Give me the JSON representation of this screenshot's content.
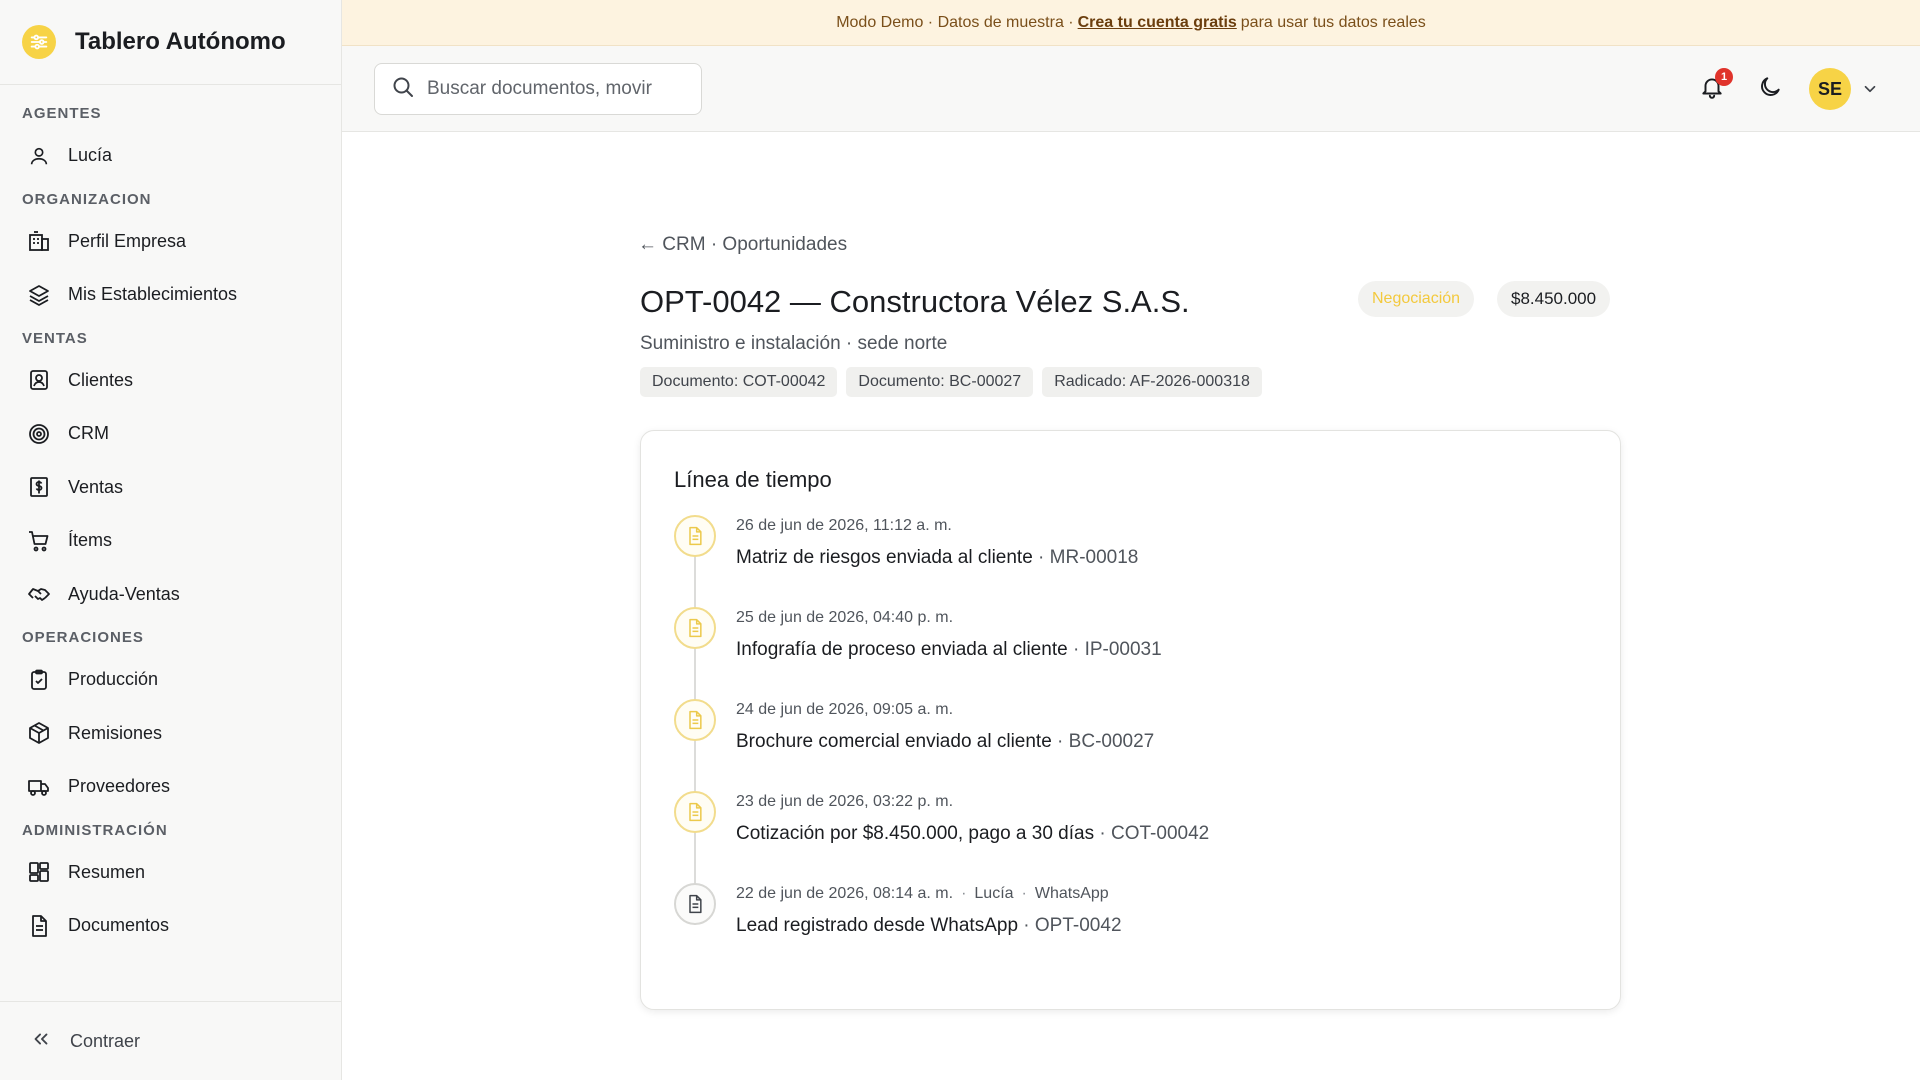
{
  "app": {
    "title": "Tablero Autónomo"
  },
  "banner": {
    "prefix": "Modo Demo · Datos de muestra ·",
    "link": "Crea tu cuenta gratis",
    "suffix": "para usar tus datos reales"
  },
  "sidebar": {
    "sections": [
      {
        "title": "AGENTES",
        "items": [
          {
            "label": "Lucía",
            "icon": "user-icon"
          }
        ]
      },
      {
        "title": "ORGANIZACION",
        "items": [
          {
            "label": "Perfil Empresa",
            "icon": "building-icon"
          },
          {
            "label": "Mis Establecimientos",
            "icon": "layers-icon"
          }
        ]
      },
      {
        "title": "VENTAS",
        "items": [
          {
            "label": "Clientes",
            "icon": "contact-icon"
          },
          {
            "label": "CRM",
            "icon": "target-icon"
          },
          {
            "label": "Ventas",
            "icon": "dollar-receipt-icon"
          },
          {
            "label": "Ítems",
            "icon": "cart-icon"
          },
          {
            "label": "Ayuda-Ventas",
            "icon": "handshake-icon"
          }
        ]
      },
      {
        "title": "OPERACIONES",
        "items": [
          {
            "label": "Producción",
            "icon": "clipboard-check-icon"
          },
          {
            "label": "Remisiones",
            "icon": "package-icon"
          },
          {
            "label": "Proveedores",
            "icon": "truck-icon"
          }
        ]
      },
      {
        "title": "ADMINISTRACIÓN",
        "items": [
          {
            "label": "Resumen",
            "icon": "dashboard-icon"
          },
          {
            "label": "Documentos",
            "icon": "document-icon"
          }
        ]
      }
    ],
    "collapse_label": "Contraer"
  },
  "topbar": {
    "search_placeholder": "Buscar documentos, movir",
    "notifications_count": "1",
    "avatar_initials": "SE"
  },
  "opportunity": {
    "breadcrumb": "← CRM · Oportunidades",
    "title": "OPT-0042 — Constructora Vélez S.A.S.",
    "subtitle": "Suministro e instalación · sede norte",
    "stage": "Negociación",
    "amount": "$8.450.000",
    "chips": [
      "Documento: COT-00042",
      "Documento: BC-00027",
      "Radicado: AF-2026-000318"
    ]
  },
  "timeline": {
    "title": "Línea de tiempo",
    "events": [
      {
        "date": "26 de jun de 2026, 11:12 a. m.",
        "text": "Matriz de riesgos enviada al cliente",
        "ref": "MR-00018"
      },
      {
        "date": "25 de jun de 2026, 04:40 p. m.",
        "text": "Infografía de proceso enviada al cliente",
        "ref": "IP-00031"
      },
      {
        "date": "24 de jun de 2026, 09:05 a. m.",
        "text": "Brochure comercial enviado al cliente",
        "ref": "BC-00027"
      },
      {
        "date": "23 de jun de 2026, 03:22 p. m.",
        "text": "Cotización por $8.450.000, pago a 30 días",
        "ref": "COT-00042"
      },
      {
        "date": "22 de jun de 2026, 08:14 a. m.",
        "agent": "Lucía",
        "channel": "WhatsApp",
        "text": "Lead registrado desde WhatsApp",
        "ref": "OPT-0042"
      }
    ]
  },
  "colors": {
    "accent": "#f7d346",
    "stage": "#f3c93d",
    "badge": "#e0332b",
    "banner_bg": "#fdf3e0"
  }
}
